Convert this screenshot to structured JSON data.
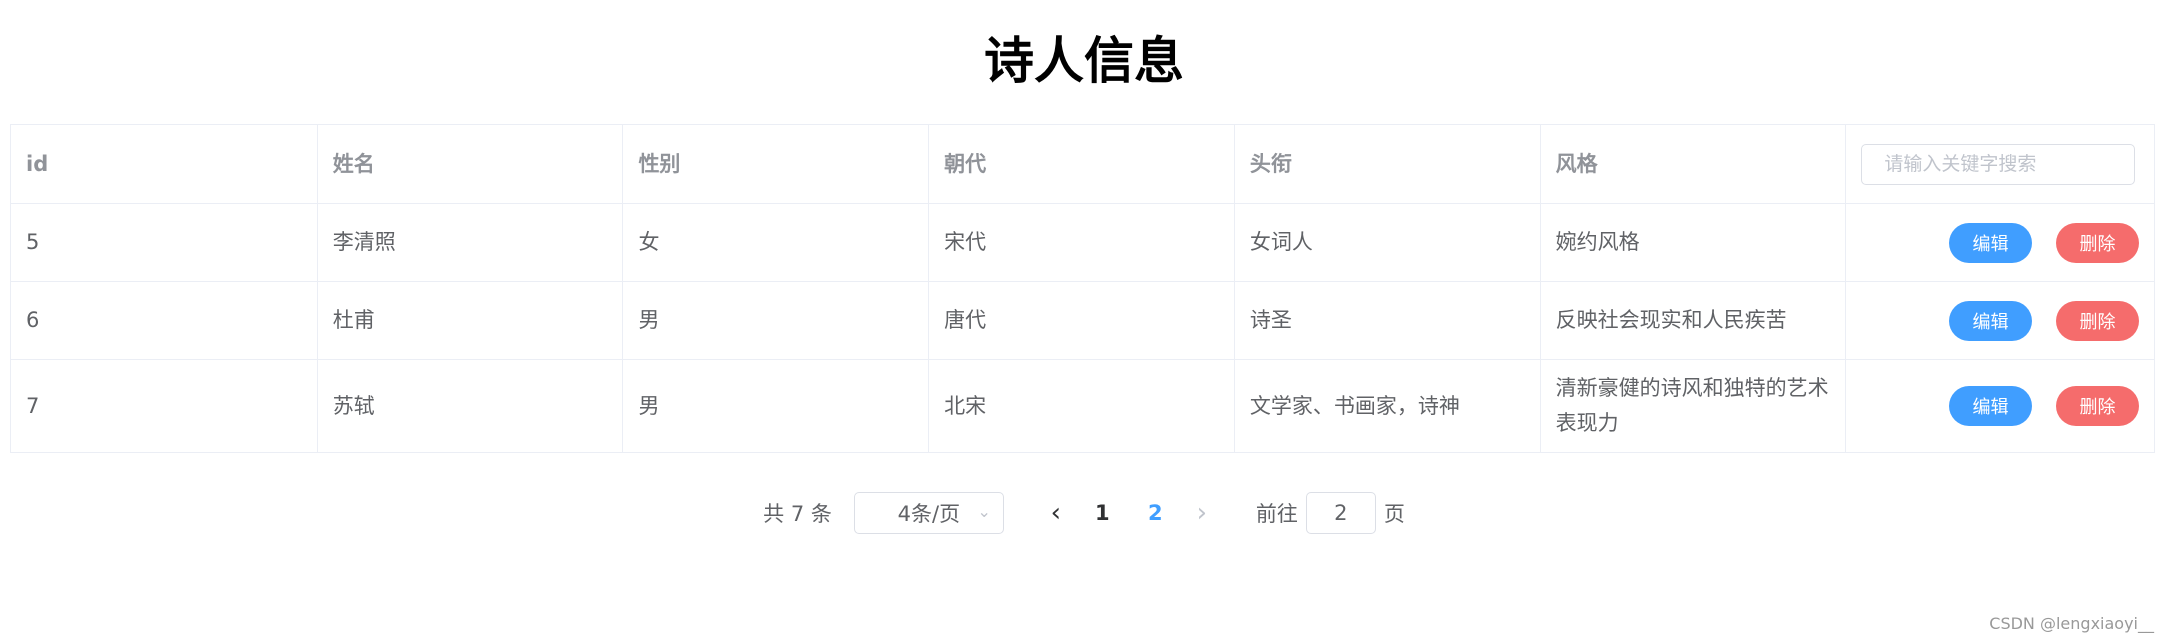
{
  "page": {
    "title": "诗人信息"
  },
  "table": {
    "headers": [
      "id",
      "姓名",
      "性别",
      "朝代",
      "头衔",
      "风格"
    ],
    "search_placeholder": "请输入关键字搜索",
    "rows": [
      {
        "id": "5",
        "name": "李清照",
        "gender": "女",
        "dynasty": "宋代",
        "title": "女词人",
        "style": "婉约风格"
      },
      {
        "id": "6",
        "name": "杜甫",
        "gender": "男",
        "dynasty": "唐代",
        "title": "诗圣",
        "style": "反映社会现实和人民疾苦"
      },
      {
        "id": "7",
        "name": "苏轼",
        "gender": "男",
        "dynasty": "北宋",
        "title": "文学家、书画家，诗神",
        "style": "清新豪健的诗风和独特的艺术表现力"
      }
    ],
    "edit_label": "编辑",
    "delete_label": "删除"
  },
  "pagination": {
    "total_text": "共 7 条",
    "page_size": "4条/页",
    "prev_icon": "chevron-left-icon",
    "next_icon": "chevron-right-icon",
    "pages": [
      "1",
      "2"
    ],
    "current_page": "2",
    "goto_prefix": "前往",
    "goto_value": "2",
    "goto_suffix": "页"
  },
  "watermark": "CSDN @lengxiaoyi__",
  "colors": {
    "primary": "#409eff",
    "danger": "#f56c6c",
    "border": "#ebeef5",
    "header_text": "#909399"
  }
}
